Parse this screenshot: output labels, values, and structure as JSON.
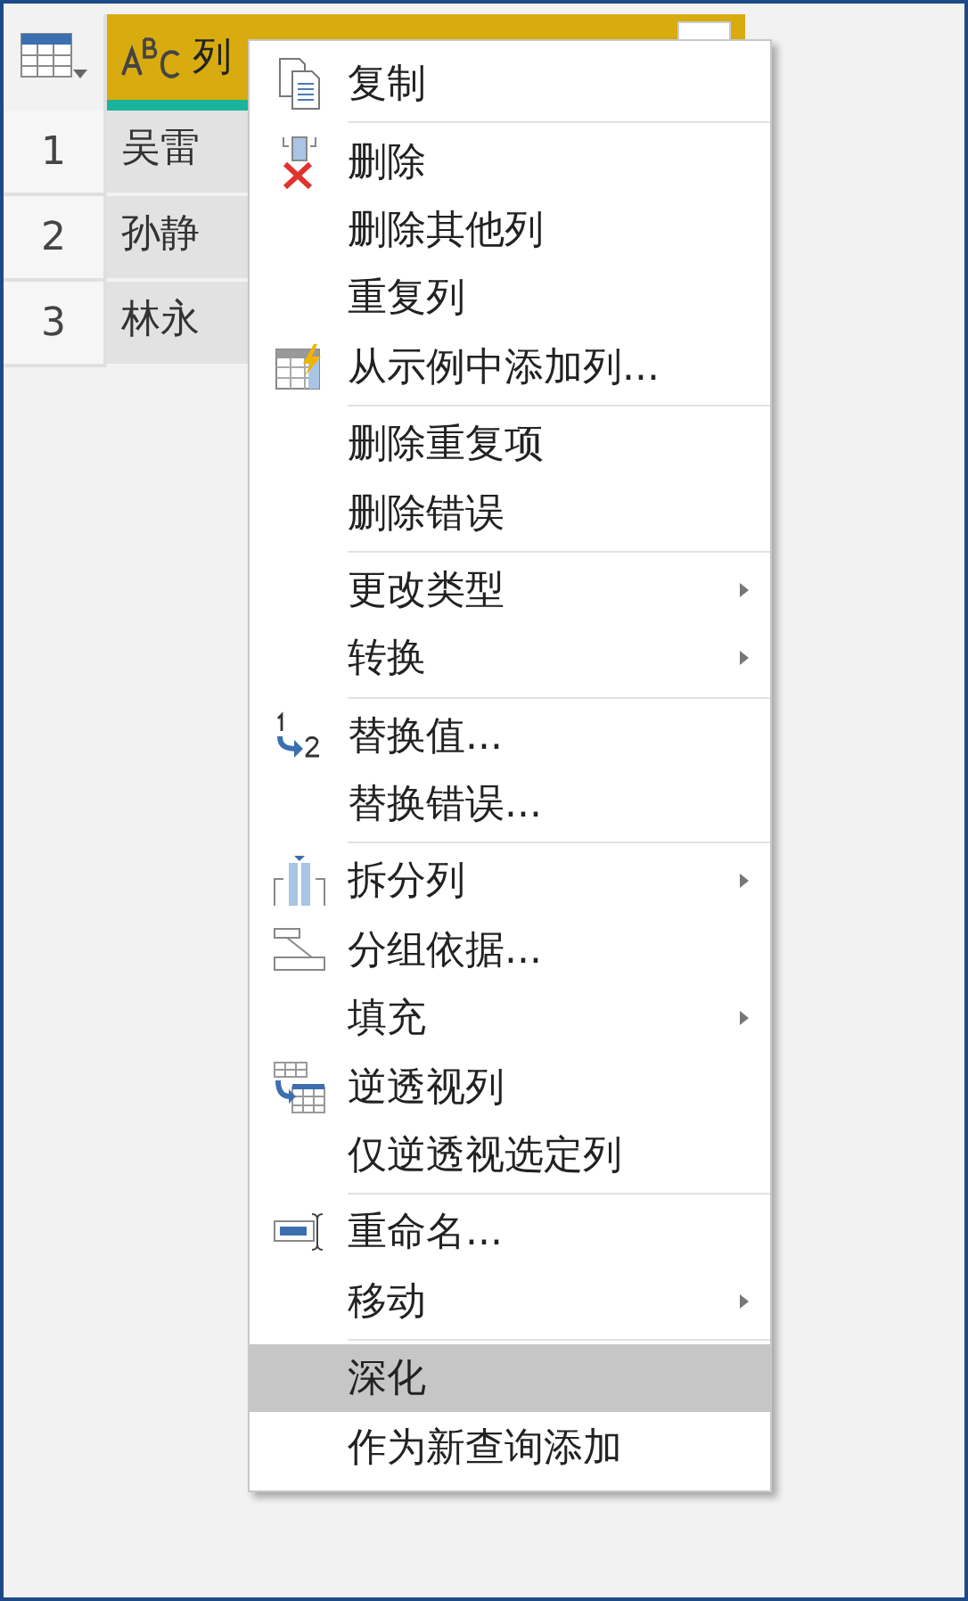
{
  "table": {
    "header": {
      "label": "列"
    },
    "rows": [
      {
        "index": "1",
        "value": "吴雷"
      },
      {
        "index": "2",
        "value": "孙静"
      },
      {
        "index": "3",
        "value": "林永"
      }
    ]
  },
  "menu": {
    "groups": [
      {
        "items": [
          {
            "label": "复制",
            "kind": "copy",
            "submenu": false,
            "selected": false
          }
        ]
      },
      {
        "items": [
          {
            "label": "删除",
            "kind": "delete",
            "submenu": false,
            "selected": false
          },
          {
            "label": "删除其他列",
            "kind": "plain",
            "submenu": false,
            "selected": false
          },
          {
            "label": "重复列",
            "kind": "plain",
            "submenu": false,
            "selected": false
          },
          {
            "label": "从示例中添加列...",
            "kind": "example",
            "submenu": false,
            "selected": false
          }
        ]
      },
      {
        "items": [
          {
            "label": "删除重复项",
            "kind": "plain",
            "submenu": false,
            "selected": false
          },
          {
            "label": "删除错误",
            "kind": "plain",
            "submenu": false,
            "selected": false
          }
        ]
      },
      {
        "items": [
          {
            "label": "更改类型",
            "kind": "plain",
            "submenu": true,
            "selected": false
          },
          {
            "label": "转换",
            "kind": "plain",
            "submenu": true,
            "selected": false
          }
        ]
      },
      {
        "items": [
          {
            "label": "替换值...",
            "kind": "replace",
            "submenu": false,
            "selected": false
          },
          {
            "label": "替换错误...",
            "kind": "plain",
            "submenu": false,
            "selected": false
          }
        ]
      },
      {
        "items": [
          {
            "label": "拆分列",
            "kind": "split",
            "submenu": true,
            "selected": false
          },
          {
            "label": "分组依据...",
            "kind": "group",
            "submenu": false,
            "selected": false
          },
          {
            "label": "填充",
            "kind": "plain",
            "submenu": true,
            "selected": false
          },
          {
            "label": "逆透视列",
            "kind": "unpivot",
            "submenu": false,
            "selected": false
          },
          {
            "label": "仅逆透视选定列",
            "kind": "plain",
            "submenu": false,
            "selected": false
          }
        ]
      },
      {
        "items": [
          {
            "label": "重命名...",
            "kind": "rename",
            "submenu": false,
            "selected": false
          },
          {
            "label": "移动",
            "kind": "plain",
            "submenu": true,
            "selected": false
          }
        ]
      },
      {
        "items": [
          {
            "label": "深化",
            "kind": "plain",
            "submenu": false,
            "selected": true
          },
          {
            "label": "作为新查询添加",
            "kind": "plain",
            "submenu": false,
            "selected": false
          }
        ]
      }
    ]
  }
}
